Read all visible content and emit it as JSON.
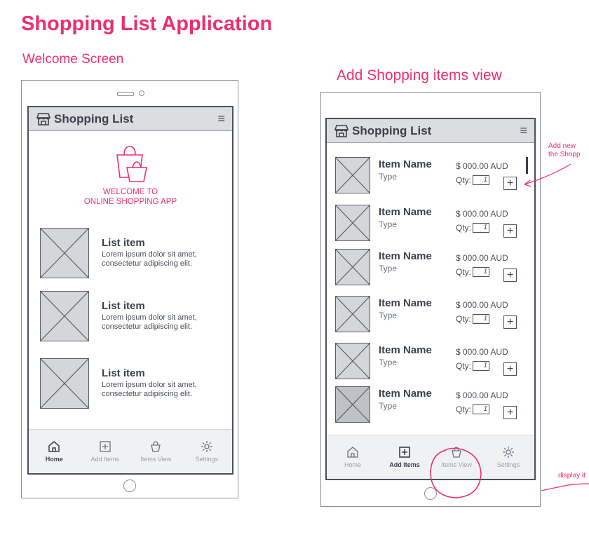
{
  "page_title": "Shopping List Application",
  "welcome_screen": {
    "label": "Welcome Screen",
    "app_title": "Shopping List",
    "welcome_line1": "WELCOME TO",
    "welcome_line2": "ONLINE SHOPPING APP",
    "list_items": [
      {
        "title": "List item",
        "desc1": "Lorem ipsum dolor sit amet,",
        "desc2": "consectetur adipiscing elit."
      },
      {
        "title": "List item",
        "desc1": "Lorem ipsum dolor sit amet,",
        "desc2": "consectetur adipiscing elit."
      },
      {
        "title": "List item",
        "desc1": "Lorem ipsum dolor sit amet,",
        "desc2": "consectetur adipiscing elit."
      }
    ],
    "nav": [
      {
        "label": "Home",
        "icon": "home-icon",
        "active": true
      },
      {
        "label": "Add Items",
        "icon": "add-box-icon",
        "active": false
      },
      {
        "label": "Items View",
        "icon": "basket-icon",
        "active": false
      },
      {
        "label": "Settings",
        "icon": "gear-icon",
        "active": false
      }
    ]
  },
  "add_items_view": {
    "label": "Add Shopping items view",
    "app_title": "Shopping List",
    "items": [
      {
        "name": "Item Name",
        "type": "Type",
        "price": "$ 000.00 AUD",
        "qty_label": "Qty:",
        "qty": "1"
      },
      {
        "name": "Item Name",
        "type": "Type",
        "price": "$ 000.00 AUD",
        "qty_label": "Qty:",
        "qty": "1"
      },
      {
        "name": "Item Name",
        "type": "Type",
        "price": "$ 000.00 AUD",
        "qty_label": "Qty:",
        "qty": "1"
      },
      {
        "name": "Item Name",
        "type": "Type",
        "price": "$ 000.00 AUD",
        "qty_label": "Qty:",
        "qty": "1"
      },
      {
        "name": "Item Name",
        "type": "Type",
        "price": "$ 000.00 AUD",
        "qty_label": "Qty:",
        "qty": "1"
      },
      {
        "name": "Item Name",
        "type": "Type",
        "price": "$ 000.00 AUD",
        "qty_label": "Qty:",
        "qty": "1"
      }
    ],
    "nav": [
      {
        "label": "Home",
        "icon": "home-icon",
        "active": false
      },
      {
        "label": "Add Items",
        "icon": "add-box-icon",
        "active": true
      },
      {
        "label": "Items View",
        "icon": "basket-icon",
        "active": false
      },
      {
        "label": "Settings",
        "icon": "gear-icon",
        "active": false
      }
    ]
  },
  "annotations": {
    "add_new_line1": "Add new",
    "add_new_line2": "the Shopp",
    "display": "display it"
  },
  "colors": {
    "accent": "#ee2f6d",
    "text": "#3a3f4a",
    "appbar": "#dcdde1",
    "placeholder": "#d4d6da"
  }
}
